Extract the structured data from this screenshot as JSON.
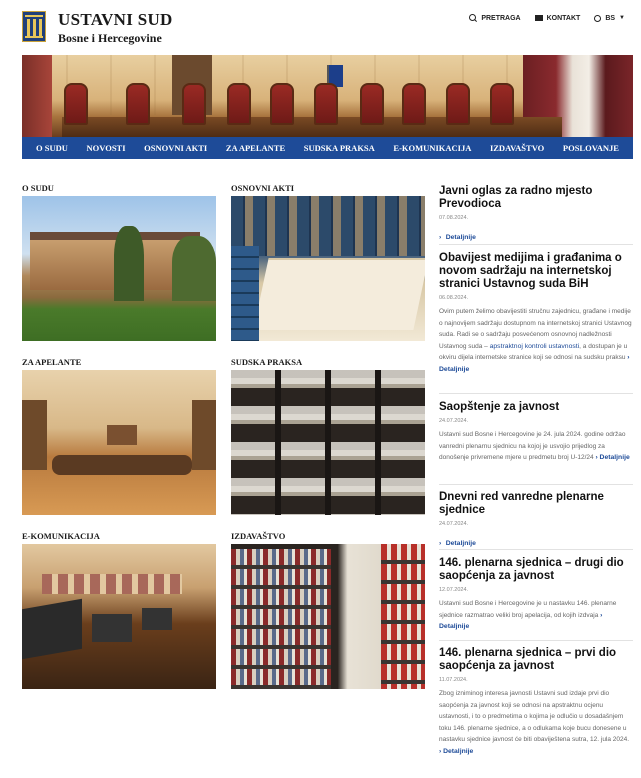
{
  "header": {
    "title": "USTAVNI SUD",
    "subtitle": "Bosne i Hercegovine",
    "links": {
      "search": "PRETRAGA",
      "contact": "KONTAKT",
      "language": "BS"
    }
  },
  "nav": [
    "O SUDU",
    "NOVOSTI",
    "OSNOVNI AKTI",
    "ZA APELANTE",
    "SUDSKA PRAKSA",
    "E-KOMUNIKACIJA",
    "IZDAVAŠTVO",
    "POSLOVANJE"
  ],
  "sections": [
    "O SUDU",
    "OSNOVNI AKTI",
    "ZA APELANTE",
    "SUDSKA PRAKSA",
    "E-KOMUNIKACIJA",
    "IZDAVAŠTVO"
  ],
  "news": [
    {
      "title": "Javni oglas za radno mjesto Prevodioca",
      "date": "07.08.2024.",
      "link": "Detaljnije"
    },
    {
      "title": "Obavijest medijima i građanima o novom sadržaju na internetskoj stranici Ustavnog suda BiH",
      "date": "06.08.2024.",
      "text": "Ovim putem želimo obavijestiti stručnu zajednicu, građane i medije o najnovijem sadržaju dostupnom na internetskoj stranici Ustavnog suda. Radi se o sadržaju posvećenom osnovnoj nadležnosti Ustavnog suda –",
      "highlight": "apstraktnoj kontroli ustavnosti",
      "text2": ", a dostupan je u okviru dijela internetske stranice koji se odnosi na sudsku praksu",
      "link": "Detaljnije"
    },
    {
      "title": "Saopštenje za javnost",
      "date": "24.07.2024.",
      "text": "Ustavni sud Bosne i Hercegovine je 24. jula 2024. godine održao vanredni plenarnu sjednicu na kojoj je usvojio prijedlog za donošenje privremene mjere u predmetu broj U-12/24",
      "link": "Detaljnije"
    },
    {
      "title": "Dnevni red vanredne plenarne sjednice",
      "date": "24.07.2024.",
      "link": "Detaljnije"
    },
    {
      "title": "146. plenarna sjednica – drugi dio saopćenja za javnost",
      "date": "12.07.2024.",
      "text": "Ustavni sud Bosne i Hercegovine je u nastavku 146. plenarne sjednice razmatrao veliki broj apelacija, od kojih izdvaja",
      "link": "Detaljnije"
    },
    {
      "title": "146. plenarna sjednica – prvi dio saopćenja za javnost",
      "date": "11.07.2024.",
      "text": "Zbog izniminog interesa javnosti Ustavni sud izdaje prvi dio saopćenja za javnost koji se odnosi na apstraktnu ocjenu ustavnosti, i to o predmetima o kojima je odlučio u dosadašnjem toku 146. plenarne sjednice, a o odlukama koje bucu donesene u nastavku sjednice javnost će biti obaviještena sutra, 12. jula 2024.",
      "link": "Detaljnije"
    }
  ]
}
